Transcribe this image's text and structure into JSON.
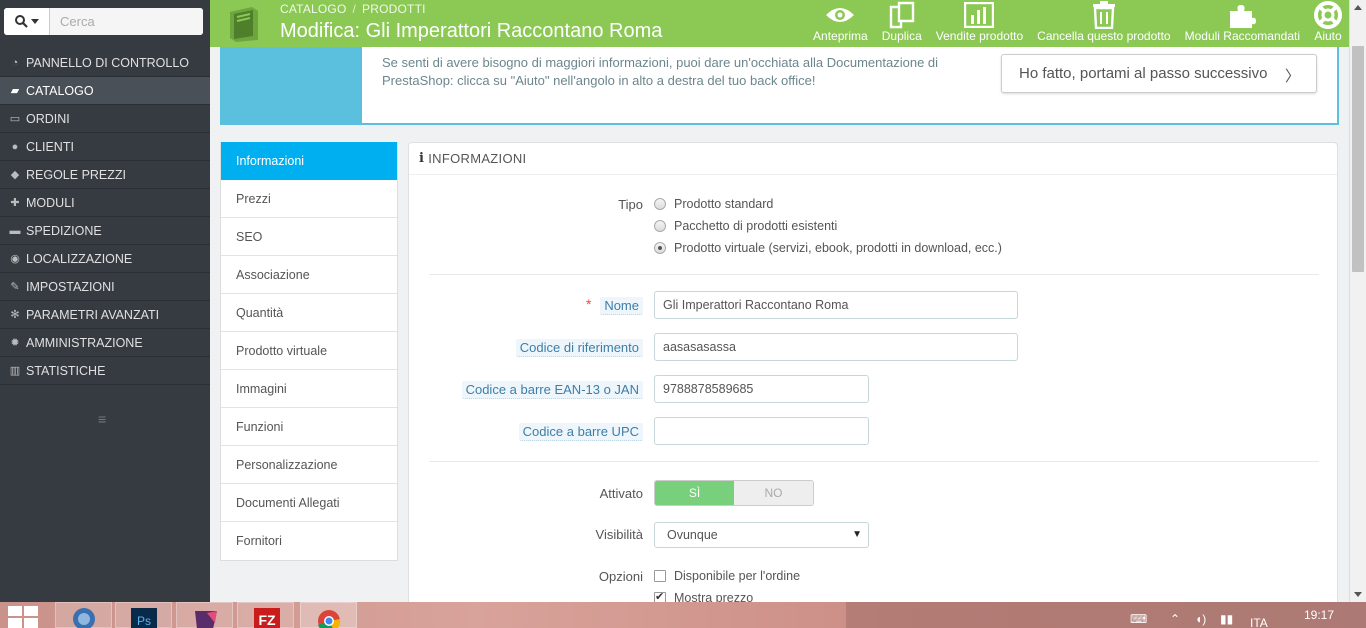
{
  "sidebar": {
    "search_placeholder": "Cerca",
    "items": [
      {
        "label": "PANNELLO DI CONTROLLO",
        "icon": "dashboard-icon"
      },
      {
        "label": "CATALOGO",
        "icon": "book-icon"
      },
      {
        "label": "ORDINI",
        "icon": "credit-card-icon"
      },
      {
        "label": "CLIENTI",
        "icon": "users-icon"
      },
      {
        "label": "REGOLE PREZZI",
        "icon": "tags-icon"
      },
      {
        "label": "MODULI",
        "icon": "puzzle-icon"
      },
      {
        "label": "SPEDIZIONE",
        "icon": "truck-icon"
      },
      {
        "label": "LOCALIZZAZIONE",
        "icon": "globe-icon"
      },
      {
        "label": "IMPOSTAZIONI",
        "icon": "wrench-icon"
      },
      {
        "label": "PARAMETRI AVANZATI",
        "icon": "cogs-icon"
      },
      {
        "label": "AMMINISTRAZIONE",
        "icon": "gear-icon"
      },
      {
        "label": "STATISTICHE",
        "icon": "bar-chart-icon"
      }
    ]
  },
  "header": {
    "breadcrumb": [
      "CATALOGO",
      "PRODOTTI"
    ],
    "title": "Modifica: Gli Imperattori Raccontano Roma",
    "toolbar": [
      {
        "label": "Anteprima",
        "icon": "eye-icon"
      },
      {
        "label": "Duplica",
        "icon": "copy-icon"
      },
      {
        "label": "Vendite prodotto",
        "icon": "bar-chart-icon"
      },
      {
        "label": "Cancella questo prodotto",
        "icon": "trash-icon"
      },
      {
        "label": "Moduli Raccomandati",
        "icon": "puzzle-icon"
      },
      {
        "label": "Aiuto",
        "icon": "lifebuoy-icon"
      }
    ]
  },
  "help": {
    "text": "Se senti di avere bisogno di maggiori informazioni, puoi dare un'occhiata alla Documentazione di PrestaShop: clicca su \"Aiuto\" nell'angolo in alto a destra del tuo back office!",
    "button": "Ho fatto, portami al passo successivo"
  },
  "tabs": [
    "Informazioni",
    "Prezzi",
    "SEO",
    "Associazione",
    "Quantità",
    "Prodotto virtuale",
    "Immagini",
    "Funzioni",
    "Personalizzazione",
    "Documenti Allegati",
    "Fornitori"
  ],
  "panel": {
    "heading": "INFORMAZIONI",
    "tipo_label": "Tipo",
    "tipo_options": [
      "Prodotto standard",
      "Pacchetto di prodotti esistenti",
      "Prodotto virtuale (servizi, ebook, prodotti in download, ecc.)"
    ],
    "tipo_selected": 2,
    "nome_label": "Nome",
    "nome_value": "Gli Imperattori Raccontano Roma",
    "ref_label": "Codice di riferimento",
    "ref_value": "aasasasassa",
    "ean_label": "Codice a barre EAN-13 o JAN",
    "ean_value": "9788878589685",
    "upc_label": "Codice a barre UPC",
    "upc_value": "",
    "attivato_label": "Attivato",
    "switch_on": "SÌ",
    "switch_off": "NO",
    "visibilita_label": "Visibilità",
    "visibilita_value": "Ovunque",
    "opzioni_label": "Opzioni",
    "opzioni": [
      {
        "label": "Disponibile per l'ordine",
        "checked": false
      },
      {
        "label": "Mostra prezzo",
        "checked": true
      }
    ]
  },
  "taskbar": {
    "time": "19:17",
    "lang": "ITA"
  }
}
